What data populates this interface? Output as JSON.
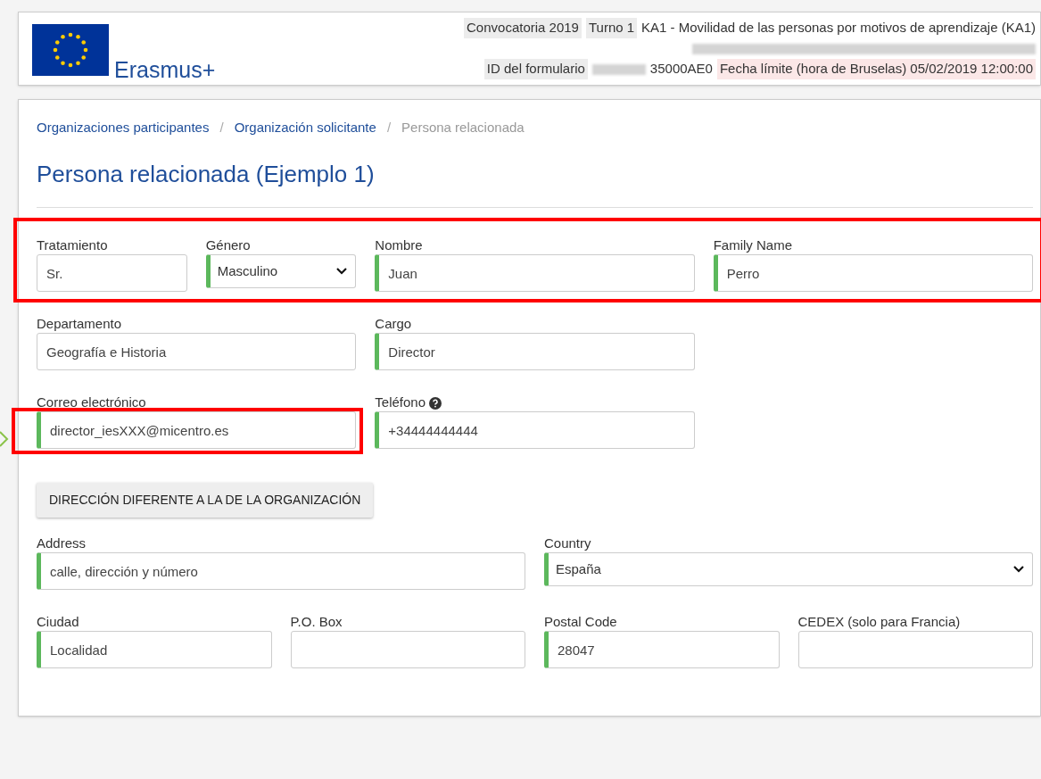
{
  "header": {
    "logo_text": "Erasmus+",
    "lines": [
      [
        {
          "kind": "chip",
          "text": "Convocatoria 2019"
        },
        {
          "kind": "chip",
          "text": "Turno 1"
        },
        {
          "kind": "plain",
          "text": "KA1 - Movilidad de las personas por motivos de aprendizaje (KA1)"
        }
      ],
      [
        {
          "kind": "redacted"
        }
      ],
      [
        {
          "kind": "chip",
          "text": "ID del formulario"
        },
        {
          "kind": "redacted"
        },
        {
          "kind": "plain",
          "text": "35000AE0"
        },
        {
          "kind": "deadline",
          "text": "Fecha límite (hora de Bruselas) 05/02/2019 12:00:00"
        }
      ]
    ]
  },
  "breadcrumb": [
    {
      "label": "Organizaciones participantes",
      "current": false
    },
    {
      "separator": "/",
      "label": "Organización solicitante",
      "current": false
    },
    {
      "separator": "/",
      "label": "Persona relacionada",
      "current": true
    }
  ],
  "title": "Persona relacionada (Ejemplo 1)",
  "person_rows": [
    {
      "highlighted": true,
      "fields": [
        {
          "kind": "text",
          "label": "Tratamiento",
          "value": "Sr.",
          "valid": false,
          "highlighted": false,
          "help": false
        },
        {
          "kind": "select",
          "label": "Género",
          "value": "Masculino",
          "valid": true,
          "highlighted": false,
          "help": false
        },
        {
          "kind": "text",
          "label": "Nombre",
          "value": "Juan",
          "valid": true,
          "highlighted": false,
          "help": false
        },
        {
          "kind": "text",
          "label": "Family Name",
          "value": "Perro",
          "valid": true,
          "highlighted": false,
          "help": false
        }
      ]
    },
    {
      "highlighted": false,
      "fields": [
        {
          "kind": "text",
          "label": "Departamento",
          "value": "Geografía e Historia",
          "valid": false,
          "highlighted": false,
          "help": false
        },
        {
          "kind": "text",
          "label": "Cargo",
          "value": "Director",
          "valid": true,
          "highlighted": false,
          "help": false
        }
      ]
    },
    {
      "highlighted": false,
      "fields": [
        {
          "kind": "text",
          "label": "Correo electrónico",
          "value": "director_iesXXX@micentro.es",
          "valid": true,
          "highlighted": true,
          "help": false
        },
        {
          "kind": "text",
          "label": "Teléfono",
          "value": "+34444444444",
          "valid": true,
          "highlighted": false,
          "help": true
        }
      ]
    }
  ],
  "address_button": "DIRECCIÓN DIFERENTE A LA DE LA ORGANIZACIÓN",
  "address_rows": [
    {
      "highlighted": false,
      "fields": [
        {
          "kind": "text",
          "label": "Address",
          "value": "calle, dirección y número",
          "valid": true,
          "highlighted": false,
          "help": false
        },
        {
          "kind": "select",
          "label": "Country",
          "value": "España",
          "valid": true,
          "highlighted": false,
          "help": false
        }
      ]
    },
    {
      "highlighted": false,
      "fields": [
        {
          "kind": "text",
          "label": "Ciudad",
          "value": "Localidad",
          "valid": true,
          "highlighted": false,
          "help": false
        },
        {
          "kind": "text",
          "label": "P.O. Box",
          "valid": false,
          "highlighted": false,
          "help": false
        },
        {
          "kind": "text",
          "label": "Postal Code",
          "value": "28047",
          "valid": true,
          "highlighted": false,
          "help": false
        },
        {
          "kind": "text",
          "label": "CEDEX (solo para Francia)",
          "valid": false,
          "highlighted": false,
          "help": false
        }
      ]
    }
  ]
}
